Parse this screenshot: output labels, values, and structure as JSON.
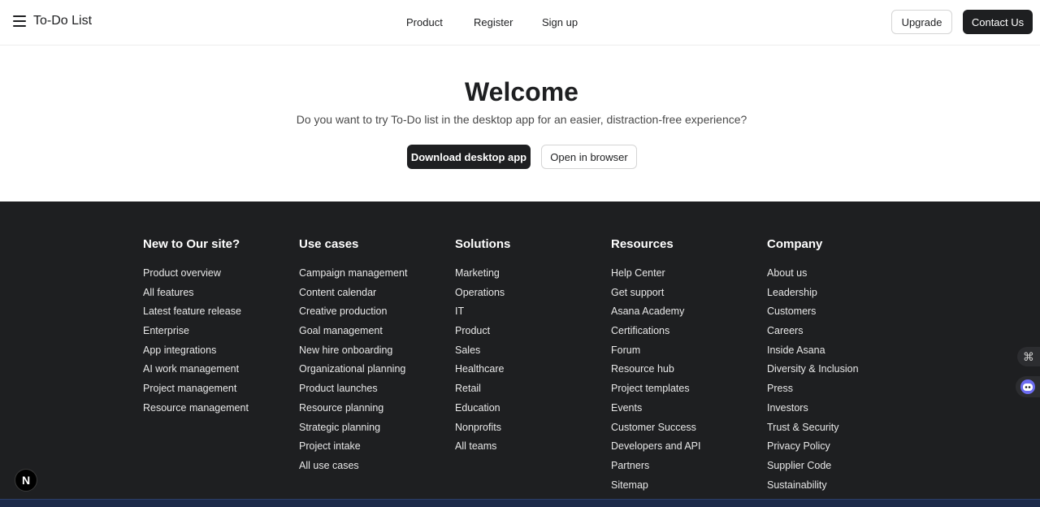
{
  "header": {
    "brand": "To-Do List",
    "nav": [
      "Product",
      "Register",
      "Sign up"
    ],
    "upgrade_label": "Upgrade",
    "contact_label": "Contact Us"
  },
  "hero": {
    "title": "Welcome",
    "subtitle": "Do you want to try To-Do list in the desktop app for an easier, distraction-free experience?",
    "download_label": "Download desktop app",
    "browser_label": "Open in browser"
  },
  "footer": {
    "columns": [
      {
        "heading": "New to Our site?",
        "links": [
          "Product overview",
          "All features",
          "Latest feature release",
          "Enterprise",
          "App integrations",
          "AI work management",
          "Project management",
          "Resource management"
        ]
      },
      {
        "heading": "Use cases",
        "links": [
          "Campaign management",
          "Content calendar",
          "Creative production",
          "Goal management",
          "New hire onboarding",
          "Organizational planning",
          "Product launches",
          "Resource planning",
          "Strategic planning",
          "Project intake",
          "All use cases"
        ]
      },
      {
        "heading": "Solutions",
        "links": [
          "Marketing",
          "Operations",
          "IT",
          "Product",
          "Sales",
          "Healthcare",
          "Retail",
          "Education",
          "Nonprofits",
          "All teams"
        ]
      },
      {
        "heading": "Resources",
        "links": [
          "Help Center",
          "Get support",
          "Asana Academy",
          "Certifications",
          "Forum",
          "Resource hub",
          "Project templates",
          "Events",
          "Customer Success",
          "Developers and API",
          "Partners",
          "Sitemap"
        ]
      },
      {
        "heading": "Company",
        "links": [
          "About us",
          "Leadership",
          "Customers",
          "Careers",
          "Inside Asana",
          "Diversity & Inclusion",
          "Press",
          "Investors",
          "Trust & Security",
          "Privacy Policy",
          "Supplier Code",
          "Sustainability"
        ]
      }
    ]
  },
  "widgets": {
    "shortcut_symbol": "⌘",
    "next_letter": "N"
  }
}
